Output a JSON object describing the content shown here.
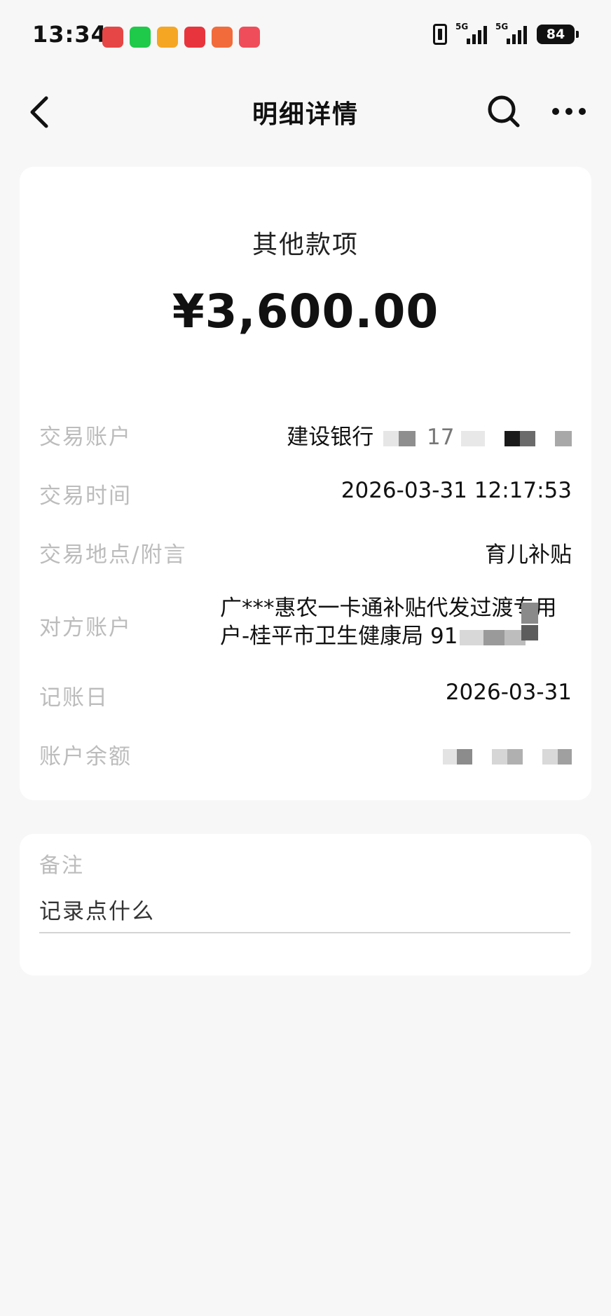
{
  "status_bar": {
    "time": "13:34",
    "network_1": "5G",
    "network_2": "5G",
    "battery": "84",
    "app_icon_colors": [
      "#e74646",
      "#1fc94a",
      "#f5a623",
      "#e8343d",
      "#f26b3a",
      "#ef4d5a"
    ]
  },
  "header": {
    "title": "明细详情",
    "icons": [
      "back-icon",
      "search-icon",
      "more-icon"
    ]
  },
  "transaction": {
    "category": "其他款项",
    "amount": "¥3,600.00",
    "rows": {
      "account": {
        "label": "交易账户",
        "value": "建设银行",
        "masked_part": "17"
      },
      "time": {
        "label": "交易时间",
        "value": "2026-03-31 12:17:53"
      },
      "location": {
        "label": "交易地点/附言",
        "value": "育儿补贴"
      },
      "counterparty": {
        "label": "对方账户",
        "line1": "广***惠农一卡通补贴代发过渡专用",
        "line2": "户-桂平市卫生健康局 91"
      },
      "posting_date": {
        "label": "记账日",
        "value": "2026-03-31"
      },
      "balance": {
        "label": "账户余额"
      }
    }
  },
  "note": {
    "label": "备注",
    "placeholder": "记录点什么"
  }
}
